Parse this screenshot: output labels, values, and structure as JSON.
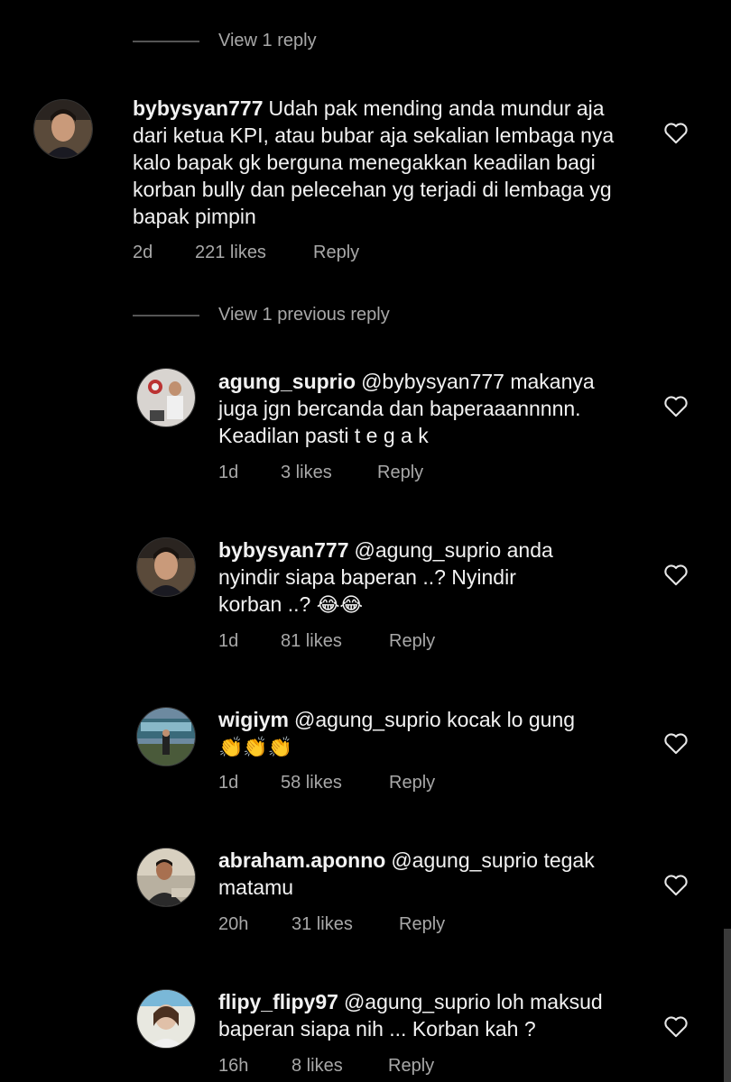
{
  "dividers": {
    "view_reply": "View 1 reply",
    "view_previous": "View 1 previous reply"
  },
  "comments": [
    {
      "username": "bybysyan777",
      "text": "Udah pak mending anda mundur aja dari ketua KPI, atau bubar aja sekalian lembaga nya kalo bapak gk berguna menegakkan keadilan bagi korban bully dan pelecehan yg terjadi di lembaga yg bapak pimpin",
      "time": "2d",
      "likes": "221 likes",
      "reply": "Reply",
      "heart_icon": "heart-outline-icon"
    },
    {
      "username": "agung_suprio",
      "text_line1": "@bybysyan777 makanya",
      "text_line2": "juga jgn bercanda dan baperaaannnnn.",
      "text_line3": "Keadilan pasti t e g a k",
      "time": "1d",
      "likes": "3 likes",
      "reply": "Reply"
    },
    {
      "username": "bybysyan777",
      "text_line1": "@agung_suprio anda",
      "text_line2": "nyindir siapa baperan ..? Nyindir",
      "text_line3": "korban ..?",
      "emoji": "😂😂",
      "time": "1d",
      "likes": "81 likes",
      "reply": "Reply"
    },
    {
      "username": "wigiym",
      "text": "@agung_suprio kocak lo gung",
      "emoji": "👏👏👏",
      "time": "1d",
      "likes": "58 likes",
      "reply": "Reply"
    },
    {
      "username": "abraham.aponno",
      "text_line1": "@agung_suprio tegak",
      "text_line2": "matamu",
      "time": "20h",
      "likes": "31 likes",
      "reply": "Reply"
    },
    {
      "username": "flipy_flipy97",
      "text_line1": "@agung_suprio loh maksud",
      "text_line2": "baperan siapa nih ... Korban kah ?",
      "time": "16h",
      "likes": "8 likes",
      "reply": "Reply"
    }
  ],
  "colors": {
    "background": "#000000",
    "text": "#f5f5f5",
    "muted": "#a8a8a8"
  }
}
